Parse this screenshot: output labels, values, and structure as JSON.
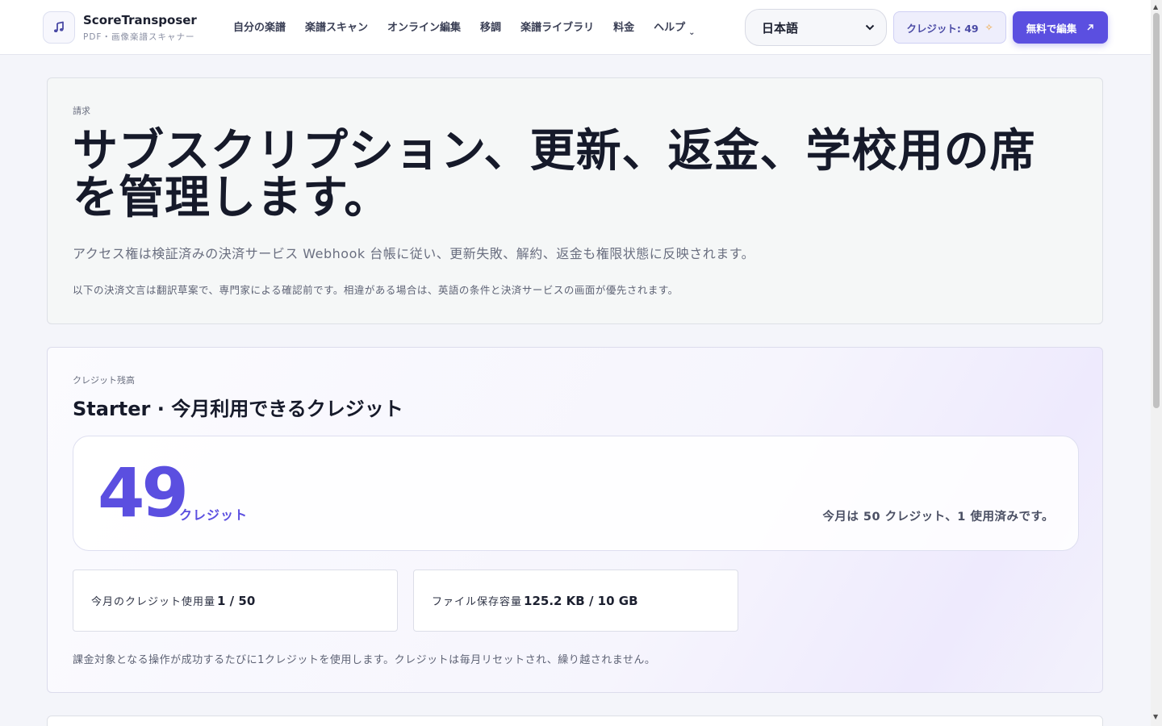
{
  "header": {
    "brand_name": "ScoreTransposer",
    "brand_sub": "PDF・画像楽譜スキャナー",
    "logo_icon": "music-note-icon",
    "nav": [
      {
        "label": "自分の楽譜"
      },
      {
        "label": "楽譜スキャン"
      },
      {
        "label": "オンライン編集"
      },
      {
        "label": "移調"
      },
      {
        "label": "楽譜ライブラリ"
      },
      {
        "label": "料金"
      },
      {
        "label": "ヘルプ"
      }
    ],
    "language": "日本語",
    "credits_label": "クレジット: 49",
    "cta_label": "無料で編集",
    "accent_color": "#5b4fe0"
  },
  "hero": {
    "eyebrow": "請求",
    "title": "サブスクリプション、更新、返金、学校用の席を管理します。",
    "description": "アクセス権は検証済みの決済サービス Webhook 台帳に従い、更新失敗、解約、返金も権限状態に反映されます。",
    "note": "以下の決済文言は翻訳草案で、専門家による確認前です。相違がある場合は、英語の条件と決済サービスの画面が優先されます。"
  },
  "credits": {
    "eyebrow": "クレジット残高",
    "title": "Starter · 今月利用できるクレジット",
    "balance": "49",
    "unit": "クレジット",
    "summary": "今月は 50 クレジット、1 使用済みです。",
    "usage_label": "今月のクレジット使用量",
    "usage_value": "1 / 50",
    "storage_label": "ファイル保存容量",
    "storage_value": "125.2 KB / 10 GB",
    "footer": "課金対象となる操作が成功するたびに1クレジットを使用します。クレジットは毎月リセットされ、繰り越されません。"
  }
}
